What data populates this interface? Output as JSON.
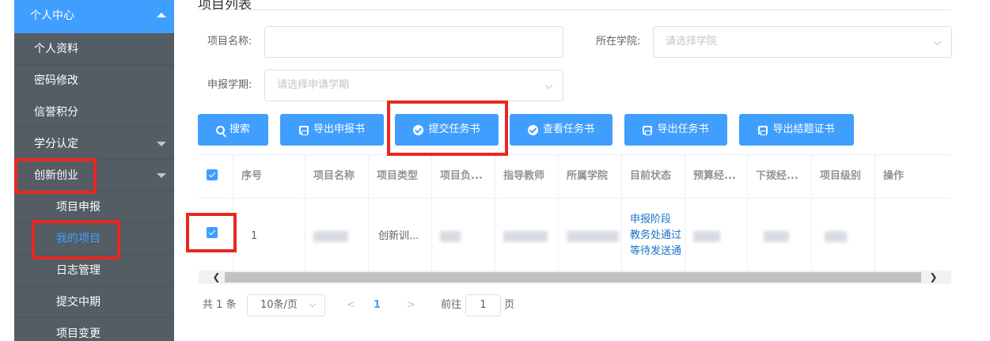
{
  "sidebar": {
    "items": [
      {
        "label": "个人中心"
      },
      {
        "label": "个人资料"
      },
      {
        "label": "密码修改"
      },
      {
        "label": "信誉积分"
      },
      {
        "label": "学分认定"
      },
      {
        "label": "创新创业"
      },
      {
        "label": "项目申报"
      },
      {
        "label": "我的项目"
      },
      {
        "label": "日志管理"
      },
      {
        "label": "提交中期"
      },
      {
        "label": "项目变更"
      }
    ]
  },
  "main": {
    "title": "项目列表",
    "filters": {
      "project_name_label": "项目名称:",
      "project_name_value": "",
      "college_label": "所在学院:",
      "college_placeholder": "请选择学院",
      "term_label": "申报学期:",
      "term_placeholder": "请选择申请学期"
    },
    "toolbar": {
      "search": "搜索",
      "export_application": "导出申报书",
      "submit_task": "提交任务书",
      "view_task": "查看任务书",
      "export_task": "导出任务书",
      "export_certificate": "导出结题证书"
    },
    "table": {
      "headers": [
        "序号",
        "项目名称",
        "项目类型",
        "项目负...",
        "指导教师",
        "所属学院",
        "目前状态",
        "预算经...",
        "下拨经...",
        "项目级别",
        "操作"
      ],
      "rows": [
        {
          "index": "1",
          "type": "创新训...",
          "status_lines": [
            "申报阶段",
            "教务处通过",
            "等待发送通"
          ]
        }
      ]
    },
    "pagination": {
      "total": "共 1 条",
      "page_size": "10条/页",
      "prev": "<",
      "current": "1",
      "next": ">",
      "goto_prefix": "前往",
      "goto_value": "1",
      "goto_suffix": "页"
    }
  },
  "colors": {
    "primary": "#409eff",
    "sidebar_bg": "#545c64",
    "highlight_box": "#e8281f"
  }
}
